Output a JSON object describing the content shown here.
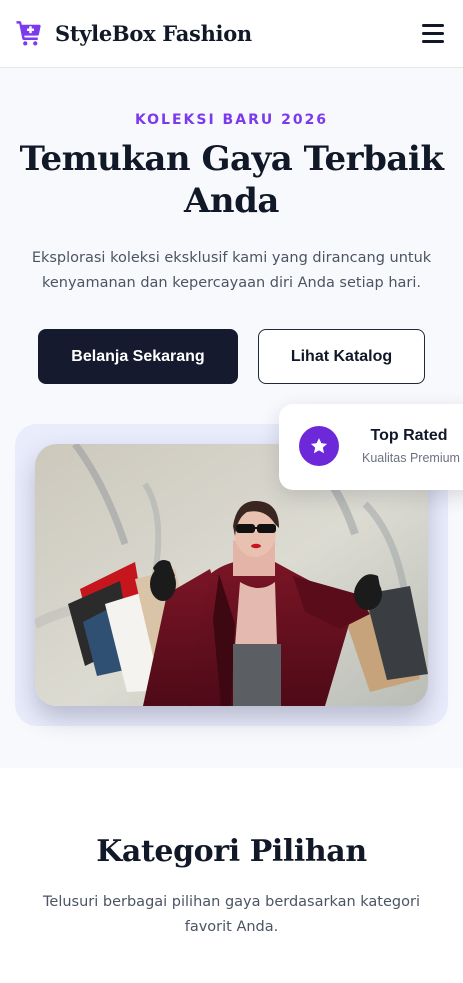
{
  "nav": {
    "brand_name": "StyleBox Fashion",
    "brand_icon": "shopping-cart-add-icon",
    "menu_icon": "hamburger-menu-icon"
  },
  "hero": {
    "eyebrow": "KOLEKSI BARU 2026",
    "title": "Temukan Gaya Terbaik Anda",
    "description": "Eksplorasi koleksi eksklusif kami yang dirancang untuk kenyamanan dan kepercayaan diri Anda setiap hari.",
    "primary_button": "Belanja Sekarang",
    "secondary_button": "Lihat Katalog",
    "image_alt": "Woman in burgundy coat holding shopping bags"
  },
  "rating_card": {
    "icon": "star-icon",
    "title": "Top Rated",
    "subtitle": "Kualitas Premium"
  },
  "categories": {
    "title": "Kategori Pilihan",
    "description": "Telusuri berbagai pilihan gaya berdasarkan kategori favorit Anda."
  },
  "colors": {
    "accent": "#7c3aed",
    "badge": "#6d28d9",
    "primary_button_bg": "#151a2e",
    "hero_bg": "#f8f9fd",
    "image_panel_bg": "#e8ecfb",
    "text_dark": "#111827",
    "text_muted": "#4b5563"
  }
}
